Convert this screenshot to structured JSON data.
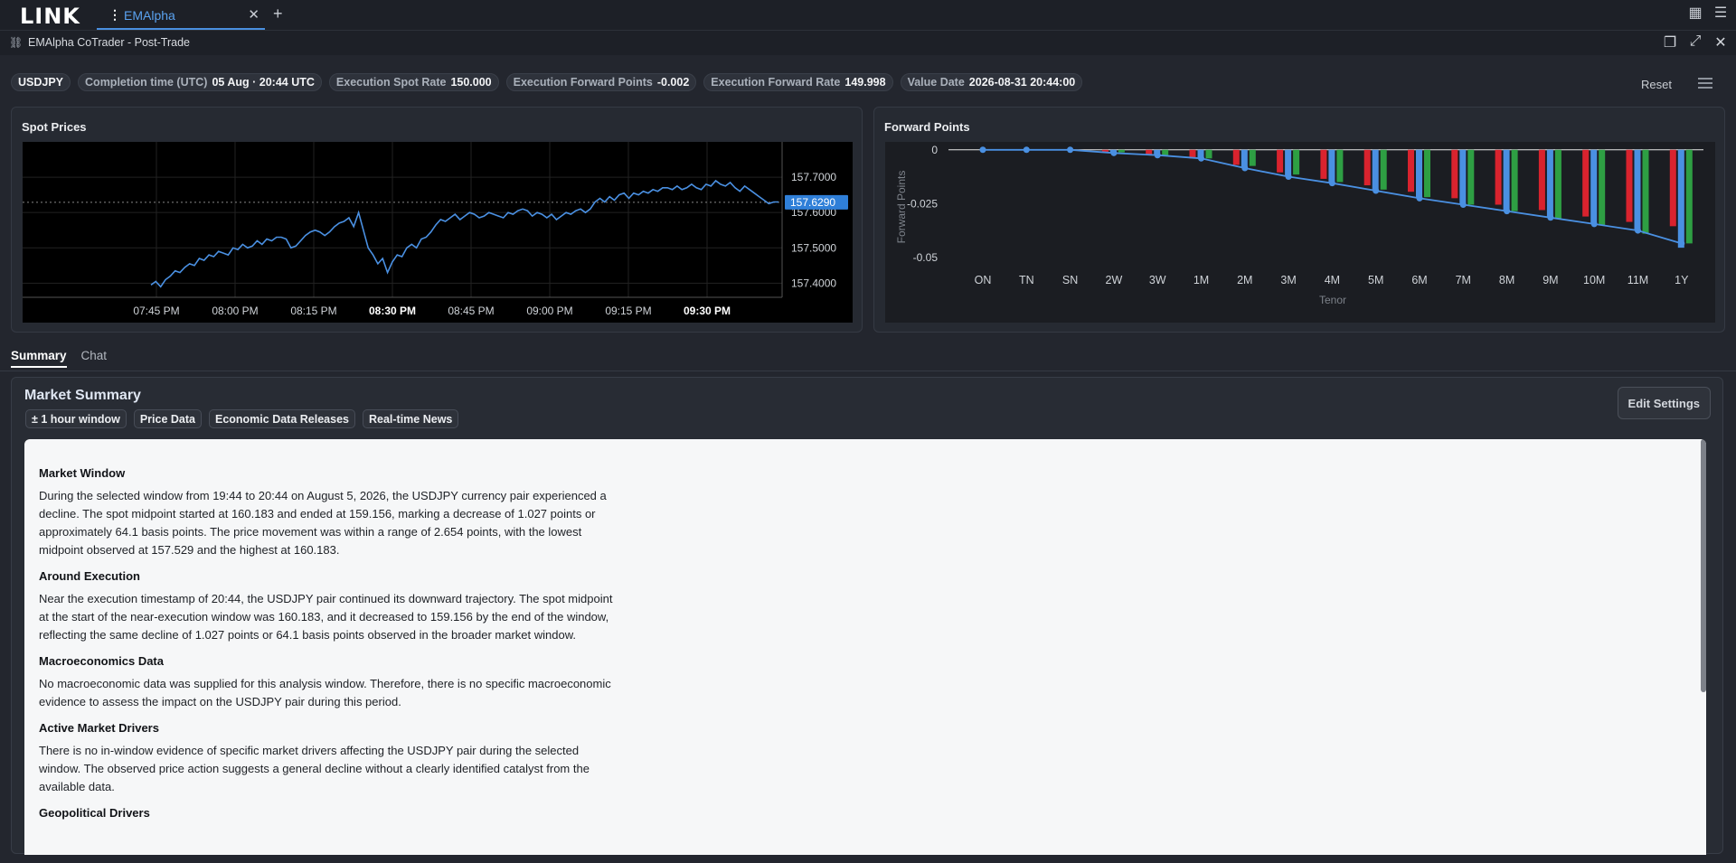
{
  "app": {
    "logo": "LINK",
    "tab_title": "EMAlpha",
    "window_title": "EMAlpha CoTrader - Post-Trade"
  },
  "chips": [
    {
      "label": "USDJPY",
      "value": ""
    },
    {
      "label": "Completion time (UTC)",
      "value": "05 Aug · 20:44 UTC"
    },
    {
      "label": "Execution Spot Rate",
      "value": "150.000"
    },
    {
      "label": "Execution Forward Points",
      "value": "-0.002"
    },
    {
      "label": "Execution Forward Rate",
      "value": "149.998"
    },
    {
      "label": "Value Date",
      "value": "2026-08-31 20:44:00"
    }
  ],
  "toolbar": {
    "reset_label": "Reset"
  },
  "spot_panel": {
    "title": "Spot Prices"
  },
  "forward_panel": {
    "title": "Forward Points"
  },
  "chart_data": [
    {
      "type": "line",
      "title": "Spot Prices",
      "x_labels": [
        "07:45 PM",
        "08:00 PM",
        "08:15 PM",
        "08:30 PM",
        "08:45 PM",
        "09:00 PM",
        "09:15 PM",
        "09:30 PM"
      ],
      "x_labels_bold": [
        "08:30 PM",
        "09:30 PM"
      ],
      "y_ticks": [
        "157.7000",
        "157.6000",
        "157.5000",
        "157.4000"
      ],
      "ylim": [
        157.36,
        157.8
      ],
      "current_value": "157.6290",
      "series": [
        {
          "color": "#4a90e2",
          "values": [
            157.395,
            157.405,
            157.39,
            157.41,
            157.42,
            157.435,
            157.43,
            157.445,
            157.455,
            157.45,
            157.47,
            157.465,
            157.48,
            157.475,
            157.49,
            157.485,
            157.48,
            157.5,
            157.495,
            157.51,
            157.5,
            157.505,
            157.52,
            157.51,
            157.525,
            157.52,
            157.53,
            157.53,
            157.525,
            157.5,
            157.505,
            157.52,
            157.535,
            157.545,
            157.55,
            157.545,
            157.535,
            157.545,
            157.56,
            157.57,
            157.575,
            157.585,
            157.56,
            157.6,
            157.55,
            157.5,
            157.48,
            157.455,
            157.47,
            157.43,
            157.46,
            157.48,
            157.475,
            157.5,
            157.51,
            157.5,
            157.525,
            157.53,
            157.545,
            157.565,
            157.58,
            157.575,
            157.585,
            157.595,
            157.58,
            157.59,
            157.6,
            157.595,
            157.585,
            157.59,
            157.6,
            157.595,
            157.59,
            157.585,
            157.6,
            157.595,
            157.605,
            157.61,
            157.605,
            157.59,
            157.6,
            157.595,
            157.585,
            157.595,
            157.58,
            157.59,
            157.6,
            157.595,
            157.605,
            157.61,
            157.6,
            157.61,
            157.63,
            157.64,
            157.63,
            157.645,
            157.635,
            157.65,
            157.655,
            157.64,
            157.655,
            157.65,
            157.66,
            157.655,
            157.665,
            157.66,
            157.67,
            157.67,
            157.665,
            157.675,
            157.665,
            157.67,
            157.68,
            157.67,
            157.665,
            157.68,
            157.675,
            157.69,
            157.68,
            157.675,
            157.685,
            157.67,
            157.66,
            157.675,
            157.665,
            157.655,
            157.645,
            157.635,
            157.625,
            157.63,
            157.63
          ]
        }
      ]
    },
    {
      "type": "bar",
      "title": "Forward Points",
      "xlabel": "Tenor",
      "ylabel": "Forward Points",
      "categories": [
        "ON",
        "TN",
        "SN",
        "2W",
        "3W",
        "1M",
        "2M",
        "3M",
        "4M",
        "5M",
        "6M",
        "7M",
        "8M",
        "9M",
        "10M",
        "11M",
        "1Y"
      ],
      "y_ticks": [
        "0",
        "-0.025",
        "-0.05"
      ],
      "ylim": [
        -0.053,
        0.002
      ],
      "series": [
        {
          "color": "#d9232e",
          "values": [
            0,
            0,
            -0.0002,
            -0.001,
            -0.0025,
            -0.004,
            -0.007,
            -0.0105,
            -0.0135,
            -0.0165,
            -0.0195,
            -0.0225,
            -0.0255,
            -0.028,
            -0.031,
            -0.0335,
            -0.0355
          ]
        },
        {
          "color": "#4a90e2",
          "values": [
            0,
            0,
            0,
            -0.0015,
            -0.0025,
            -0.004,
            -0.0085,
            -0.0125,
            -0.0155,
            -0.019,
            -0.0225,
            -0.0255,
            -0.0285,
            -0.0315,
            -0.0345,
            -0.0375,
            -0.0455
          ]
        },
        {
          "color": "#2e9f43",
          "values": [
            0,
            0,
            0,
            -0.0012,
            -0.0025,
            -0.004,
            -0.0075,
            -0.0115,
            -0.015,
            -0.0185,
            -0.022,
            -0.0255,
            -0.0285,
            -0.032,
            -0.035,
            -0.039,
            -0.0435
          ]
        }
      ],
      "line": {
        "color": "#4a90e2",
        "values": [
          0,
          0,
          0,
          -0.0015,
          -0.0025,
          -0.004,
          -0.0085,
          -0.0125,
          -0.0155,
          -0.019,
          -0.0225,
          -0.0255,
          -0.0285,
          -0.0315,
          -0.0345,
          -0.0375,
          -0.0435
        ]
      }
    }
  ],
  "subtabs": {
    "summary": "Summary",
    "chat": "Chat"
  },
  "summary": {
    "title": "Market Summary",
    "tags": [
      "± 1 hour window",
      "Price Data",
      "Economic Data Releases",
      "Real-time News"
    ],
    "edit_label": "Edit Settings",
    "sections": [
      {
        "heading": "Market Window",
        "body": "During the selected window from 19:44 to 20:44 on August 5, 2026, the USDJPY currency pair experienced a decline. The spot midpoint started at 160.183 and ended at 159.156, marking a decrease of 1.027 points or approximately 64.1 basis points. The price movement was within a range of 2.654 points, with the lowest midpoint observed at 157.529 and the highest at 160.183."
      },
      {
        "heading": "Around Execution",
        "body": "Near the execution timestamp of 20:44, the USDJPY pair continued its downward trajectory. The spot midpoint at the start of the near-execution window was 160.183, and it decreased to 159.156 by the end of the window, reflecting the same decline of 1.027 points or 64.1 basis points observed in the broader market window."
      },
      {
        "heading": "Macroeconomics Data",
        "body": "No macroeconomic data was supplied for this analysis window. Therefore, there is no specific macroeconomic evidence to assess the impact on the USDJPY pair during this period."
      },
      {
        "heading": "Active Market Drivers",
        "body": "There is no in-window evidence of specific market drivers affecting the USDJPY pair during the selected window. The observed price action suggests a general decline without a clearly identified catalyst from the available data."
      },
      {
        "heading": "Geopolitical Drivers",
        "body": ""
      }
    ]
  }
}
